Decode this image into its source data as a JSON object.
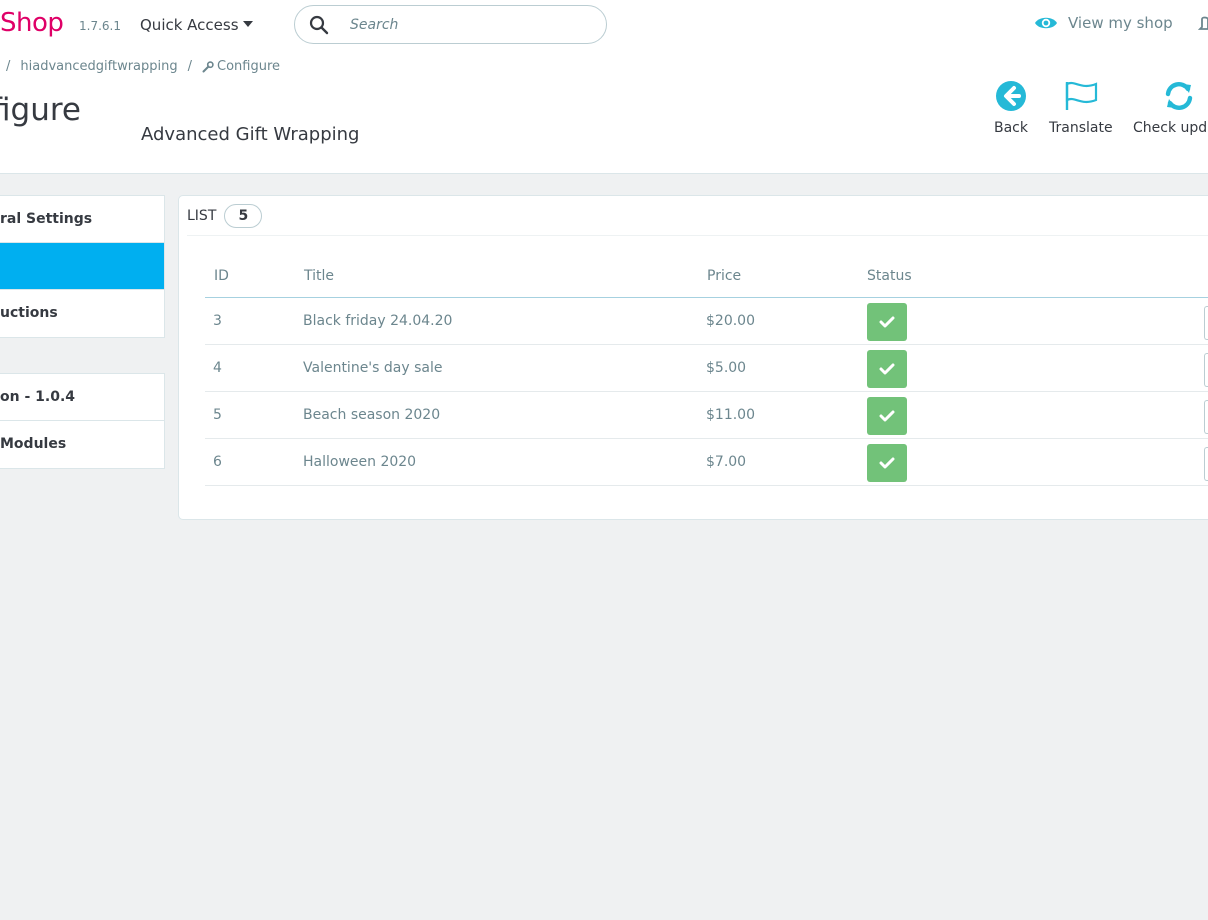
{
  "header": {
    "logo_text": "Shop",
    "version": "1.7.6.1",
    "quick_access": "Quick Access",
    "search_placeholder": "Search",
    "view_shop": "View my shop"
  },
  "breadcrumb": {
    "module": "hiadvancedgiftwrapping",
    "current": "Configure"
  },
  "page": {
    "title": "figure",
    "subtitle": "Advanced Gift Wrapping"
  },
  "toolbar": {
    "back": "Back",
    "translate": "Translate",
    "check_update": "Check upda"
  },
  "sidebar": {
    "group1": [
      {
        "label": "ral Settings"
      },
      {
        "label": ""
      },
      {
        "label": "uctions"
      }
    ],
    "group2": [
      {
        "label": "on - 1.0.4"
      },
      {
        "label": " Modules"
      }
    ]
  },
  "list": {
    "title": "LIST",
    "count": "5",
    "columns": [
      "ID",
      "Title",
      "Price",
      "Status"
    ],
    "rows": [
      {
        "id": "3",
        "title": "Black friday 24.04.20",
        "price": "$20.00"
      },
      {
        "id": "4",
        "title": "Valentine's day sale",
        "price": "$5.00"
      },
      {
        "id": "5",
        "title": "Beach season 2020",
        "price": "$11.00"
      },
      {
        "id": "6",
        "title": "Halloween 2020",
        "price": "$7.00"
      }
    ]
  },
  "colors": {
    "brand": "#df0067",
    "accent": "#25b9d7",
    "active_menu": "#00aff0",
    "status_enabled": "#72c279"
  }
}
